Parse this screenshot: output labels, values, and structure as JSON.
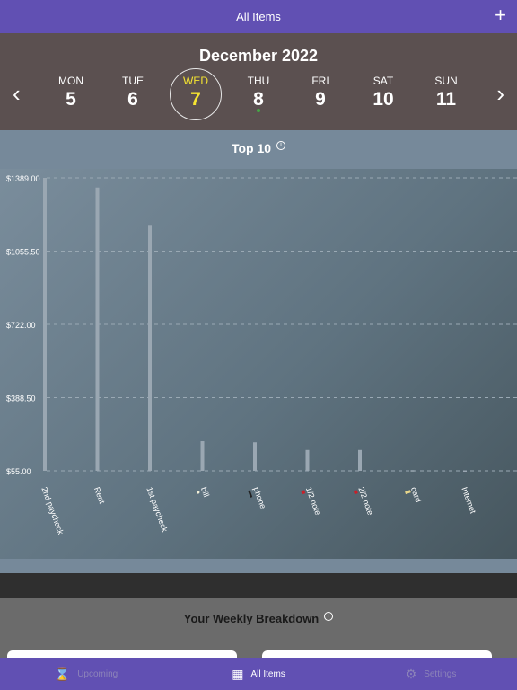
{
  "navbar": {
    "title": "All Items",
    "add_label": "+"
  },
  "week": {
    "month": "December 2022",
    "prev_label": "‹",
    "next_label": "›",
    "days": [
      {
        "name": "MON",
        "date": "5"
      },
      {
        "name": "TUE",
        "date": "6"
      },
      {
        "name": "WED",
        "date": "7"
      },
      {
        "name": "THU",
        "date": "8"
      },
      {
        "name": "FRI",
        "date": "9"
      },
      {
        "name": "SAT",
        "date": "10"
      },
      {
        "name": "SUN",
        "date": "11"
      }
    ],
    "selected_day": "WED",
    "day_with_item": "THU"
  },
  "chart_section": {
    "title": "Top 10",
    "info_icon": "ⓘ"
  },
  "chart_data": {
    "type": "bar",
    "categories": [
      "2nd paycheck",
      "Rent",
      "1st paycheck",
      "bill",
      "phone",
      "1/2 note",
      "2/2 note",
      "card",
      "Internet"
    ],
    "category_icons": [
      "",
      "",
      "",
      "lightbulb-icon",
      "phone-icon",
      "car-icon",
      "car-icon",
      "card-icon",
      ""
    ],
    "values": [
      1389,
      1345,
      1175,
      190,
      185,
      150,
      150,
      58,
      57
    ],
    "ylim": [
      55,
      1389
    ],
    "yticks": [
      "$1389.00",
      "$1055.50",
      "$722.00",
      "$388.50",
      "$55.00"
    ],
    "grid": true
  },
  "breakdown": {
    "title": "Your Weekly Breakdown",
    "info_icon": "ⓘ"
  },
  "tabs": [
    {
      "label": "Upcoming",
      "icon": "hourglass-icon",
      "glyph": "⌛"
    },
    {
      "label": "All Items",
      "icon": "calendar-icon",
      "glyph": "▦"
    },
    {
      "label": "Settings",
      "icon": "gear-icon",
      "glyph": "⚙"
    }
  ],
  "colors": {
    "nav": "#6150b3",
    "selected_day": "#f5e431",
    "dot": "#45a845"
  }
}
